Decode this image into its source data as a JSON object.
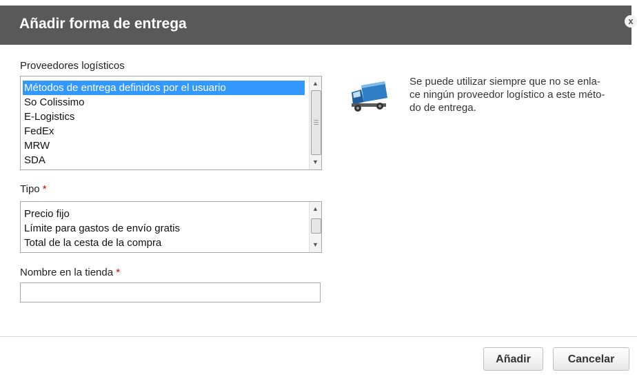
{
  "dialog": {
    "title": "Añadir forma de entrega",
    "close_label": "x"
  },
  "providers": {
    "label": "Proveedores logísticos",
    "options": [
      "Métodos de entrega definidos por el usuario",
      "So Colissimo",
      "E-Logistics",
      "FedEx",
      "MRW",
      "SDA"
    ],
    "selected_index": 0
  },
  "tipo": {
    "label": "Tipo",
    "required_mark": "*",
    "options": [
      "Precio fijo",
      "Límite para gastos de envío gratis",
      "Total de la cesta de la compra"
    ]
  },
  "store_name": {
    "label": "Nombre en la tienda",
    "required_mark": "*",
    "value": ""
  },
  "description": "Se puede utilizar siempre que no se enla-ce ningún proveedor logístico a este méto-do de entrega.",
  "description_lines": [
    "Se puede utilizar siempre que no se enla-",
    "ce ningún proveedor logístico a este méto-",
    "do de entrega."
  ],
  "buttons": {
    "add": "Añadir",
    "cancel": "Cancelar"
  },
  "icons": {
    "truck": "delivery-truck-icon",
    "close": "close-icon"
  },
  "colors": {
    "titlebar": "#595959",
    "selected": "#3399ff",
    "required": "#d00000"
  }
}
